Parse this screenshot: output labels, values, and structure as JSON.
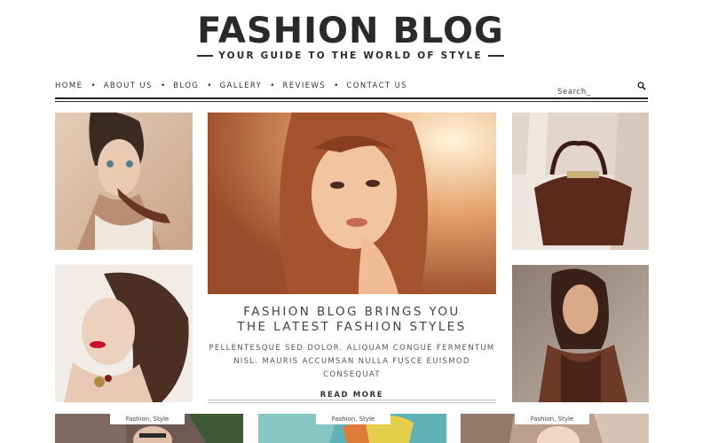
{
  "header": {
    "logo": "FASHION BLOG",
    "tagline": "YOUR GUIDE TO THE WORLD OF STYLE"
  },
  "nav": {
    "items": [
      "HOME",
      "ABOUT US",
      "BLOG",
      "GALLERY",
      "REVIEWS",
      "CONTACT US"
    ],
    "separator": "•"
  },
  "search": {
    "placeholder": "Search_"
  },
  "featured": {
    "headline_line1": "FASHION BLOG BRINGS YOU",
    "headline_line2": "THE LATEST FASHION STYLES",
    "excerpt_line1": "PELLENTESQUE SED DOLOR. ALIQUAM CONGUE FERMENTUM",
    "excerpt_line2": "NISL. MAURIS ACCUMSAN NULLA FUSCE EUISMOD CONSEQUAT",
    "read_more": "READ MORE"
  },
  "tags": [
    "Fashion, Style",
    "Fashion, Style",
    "Fashion, Style"
  ],
  "colors": {
    "text_dark": "#2a2a2a",
    "photo_warm": "#c9a48a",
    "photo_orange": "#e08a55"
  }
}
